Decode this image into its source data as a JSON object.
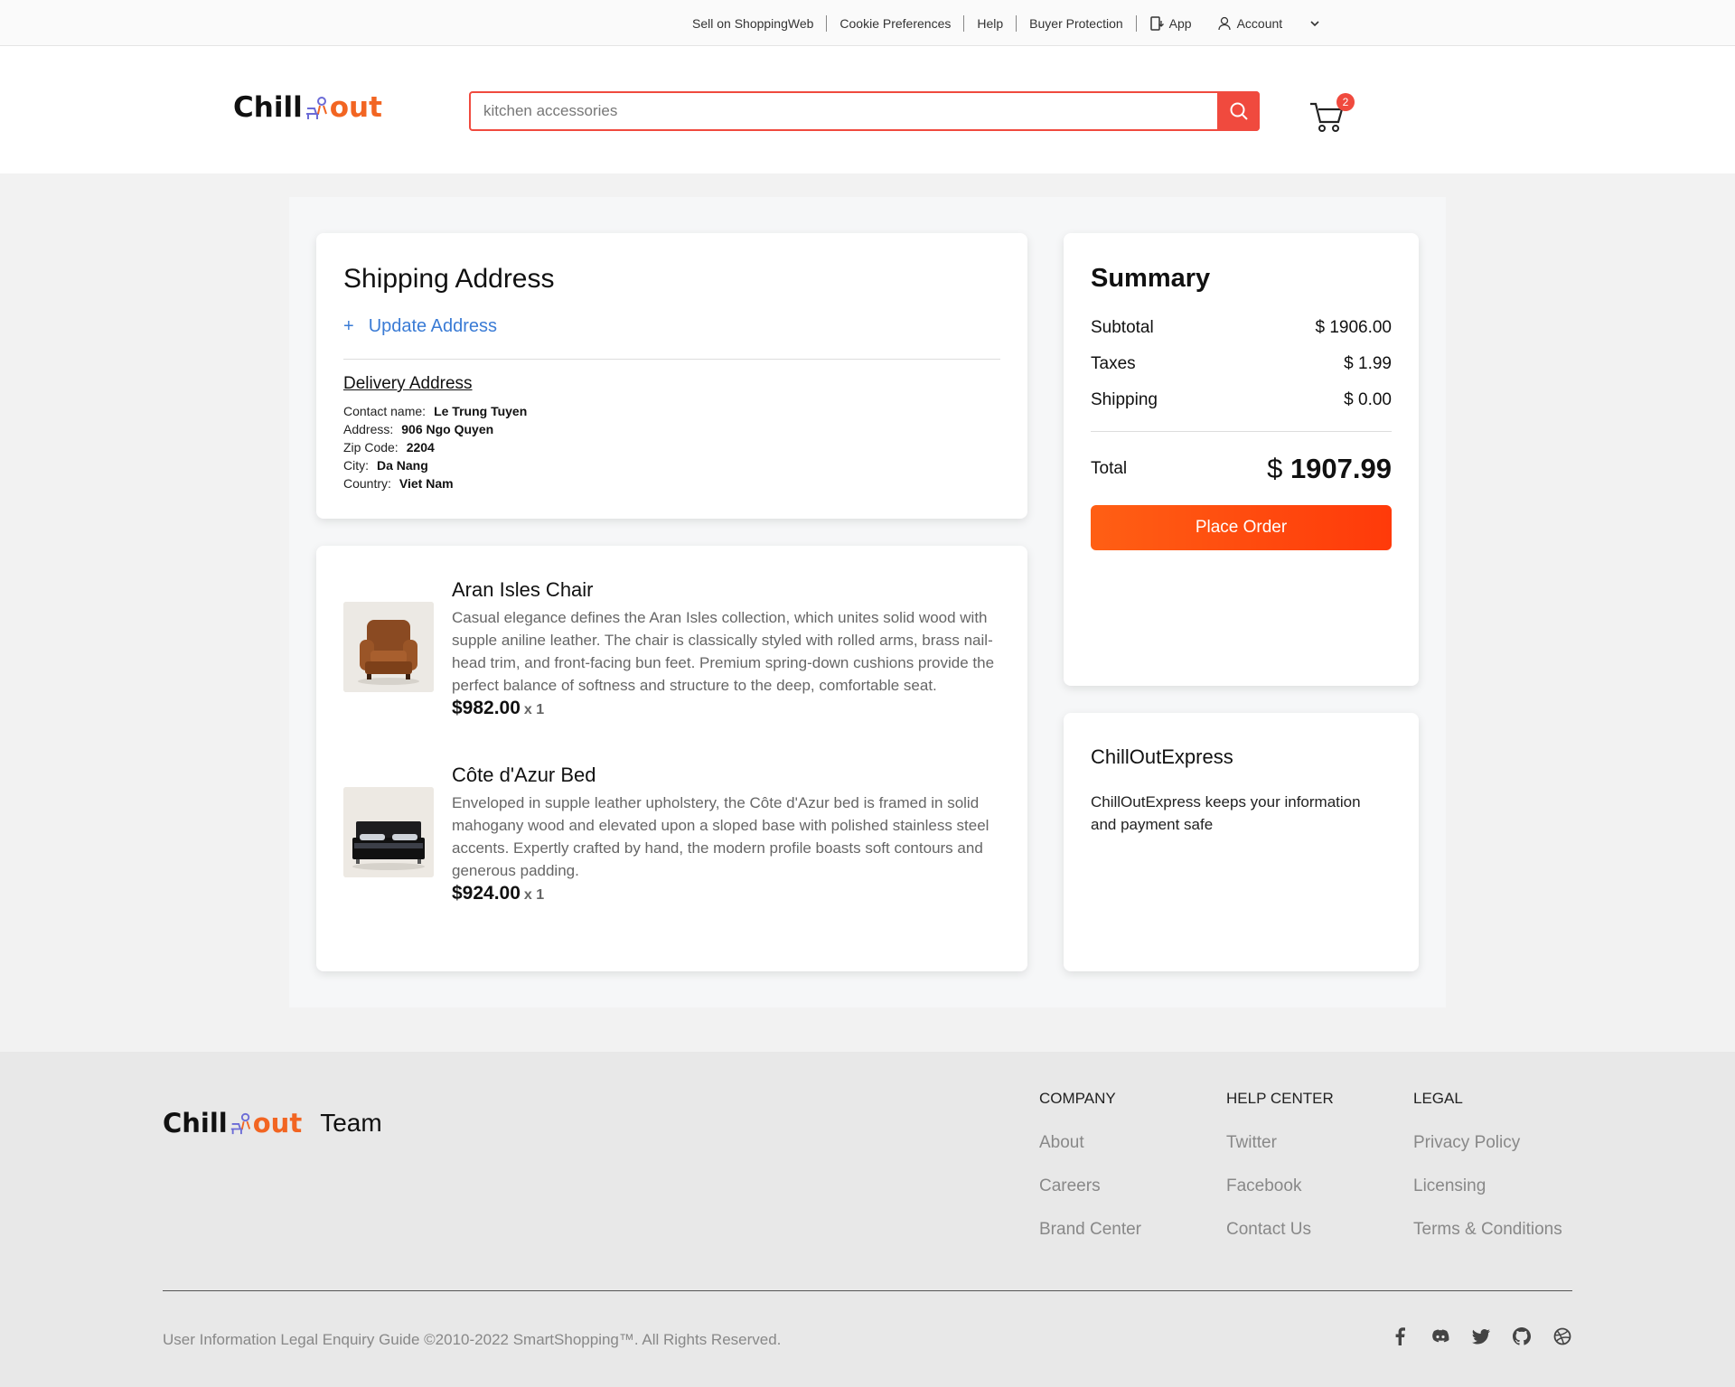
{
  "topbar": {
    "links": [
      "Sell on ShoppingWeb",
      "Cookie Preferences",
      "Help",
      "Buyer Protection"
    ],
    "app_label": "App",
    "account_label": "Account"
  },
  "header": {
    "logo": {
      "left": "Chill",
      "right": "out"
    },
    "search_placeholder": "kitchen accessories",
    "cart_count": "2"
  },
  "shipping": {
    "title": "Shipping Address",
    "update_icon": "+",
    "update_label": "Update Address",
    "delivery_title": "Delivery Address",
    "fields": [
      {
        "label": "Contact name:",
        "value": "Le Trung Tuyen"
      },
      {
        "label": "Address:",
        "value": "906 Ngo Quyen"
      },
      {
        "label": "Zip Code:",
        "value": "2204"
      },
      {
        "label": "City:",
        "value": "Da Nang"
      },
      {
        "label": "Country:",
        "value": "Viet Nam"
      }
    ]
  },
  "items": [
    {
      "title": "Aran Isles Chair",
      "description": "Casual elegance defines the Aran Isles collection, which unites solid wood with supple aniline leather. The chair is classically styled with rolled arms, brass nail-head trim, and front-facing bun feet. Premium spring-down cushions provide the perfect balance of softness and structure to the deep, comfortable seat.",
      "price": "$982.00",
      "qty": "x 1"
    },
    {
      "title": "Côte d'Azur Bed",
      "description": "Enveloped in supple leather upholstery, the Côte d'Azur bed is framed in solid mahogany wood and elevated upon a sloped base with polished stainless steel accents. Expertly crafted by hand, the modern profile boasts soft contours and generous padding.",
      "price": "$924.00",
      "qty": "x 1"
    }
  ],
  "summary": {
    "title": "Summary",
    "rows": [
      {
        "label": "Subtotal",
        "value": "$ 1906.00"
      },
      {
        "label": "Taxes",
        "value": "$ 1.99"
      },
      {
        "label": "Shipping",
        "value": "$ 0.00"
      }
    ],
    "total_label": "Total",
    "total_currency": "$",
    "total_value": "1907.99",
    "place_order": "Place Order"
  },
  "express": {
    "title": "ChillOutExpress",
    "text": "ChillOutExpress keeps your information and payment safe"
  },
  "footer": {
    "team": "Team",
    "columns": [
      {
        "title": "COMPANY",
        "links": [
          "About",
          "Careers",
          "Brand Center"
        ]
      },
      {
        "title": "HELP CENTER",
        "links": [
          "Twitter",
          "Facebook",
          "Contact Us"
        ]
      },
      {
        "title": "LEGAL",
        "links": [
          "Privacy Policy",
          "Licensing",
          "Terms & Conditions"
        ]
      }
    ],
    "copyright": "User Information Legal Enquiry Guide ©2010-2022 SmartShopping™. All Rights Reserved.",
    "socials": [
      "facebook-icon",
      "discord-icon",
      "twitter-icon",
      "github-icon",
      "dribbble-icon"
    ]
  },
  "colors": {
    "accent": "#f04a3e",
    "brand_orange": "#f26522",
    "link_blue": "#3a7bd5",
    "order_button": "#ff4d0f"
  }
}
